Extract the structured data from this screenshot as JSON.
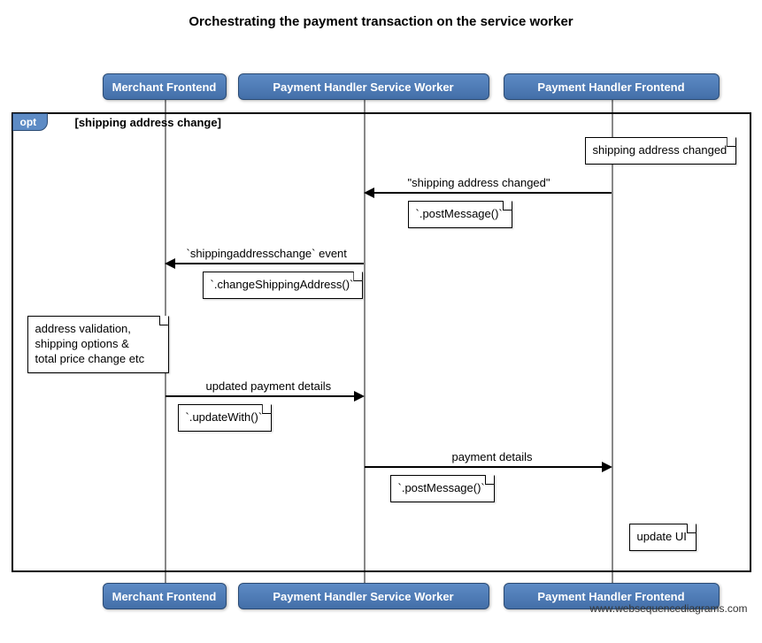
{
  "title": "Orchestrating the payment transaction on the service worker",
  "participants": [
    {
      "id": "merchant",
      "label": "Merchant Frontend"
    },
    {
      "id": "sw",
      "label": "Payment Handler Service Worker"
    },
    {
      "id": "frontend",
      "label": "Payment Handler Frontend"
    }
  ],
  "fragment": {
    "type": "opt",
    "guard": "[shipping address change]"
  },
  "notes": {
    "addr_changed": "shipping address changed",
    "post_msg1": "`.postMessage()`",
    "change_addr": "`.changeShippingAddress()`",
    "validation": "address validation,\nshipping options &\ntotal price change etc",
    "update_with": "`.updateWith()`",
    "post_msg2": "`.postMessage()`",
    "update_ui": "update UI"
  },
  "messages": {
    "m1": "\"shipping address changed\"",
    "m2": "`shippingaddresschange` event",
    "m3": "updated payment details",
    "m4": "payment details"
  },
  "watermark": "www.websequencediagrams.com",
  "chart_data": {
    "type": "sequence-diagram",
    "title": "Orchestrating the payment transaction on the service worker",
    "participants": [
      "Merchant Frontend",
      "Payment Handler Service Worker",
      "Payment Handler Frontend"
    ],
    "fragments": [
      {
        "type": "opt",
        "guard": "shipping address change",
        "steps": [
          {
            "type": "note",
            "at": "Payment Handler Frontend",
            "text": "shipping address changed"
          },
          {
            "type": "message",
            "from": "Payment Handler Frontend",
            "to": "Payment Handler Service Worker",
            "label": "\"shipping address changed\"",
            "note": "`.postMessage()`"
          },
          {
            "type": "message",
            "from": "Payment Handler Service Worker",
            "to": "Merchant Frontend",
            "label": "`shippingaddresschange` event",
            "note": "`.changeShippingAddress()`"
          },
          {
            "type": "note",
            "at": "Merchant Frontend",
            "text": "address validation, shipping options & total price change etc"
          },
          {
            "type": "message",
            "from": "Merchant Frontend",
            "to": "Payment Handler Service Worker",
            "label": "updated payment details",
            "note": "`.updateWith()`"
          },
          {
            "type": "message",
            "from": "Payment Handler Service Worker",
            "to": "Payment Handler Frontend",
            "label": "payment details",
            "note": "`.postMessage()`"
          },
          {
            "type": "note",
            "at": "Payment Handler Frontend",
            "text": "update UI"
          }
        ]
      }
    ]
  }
}
